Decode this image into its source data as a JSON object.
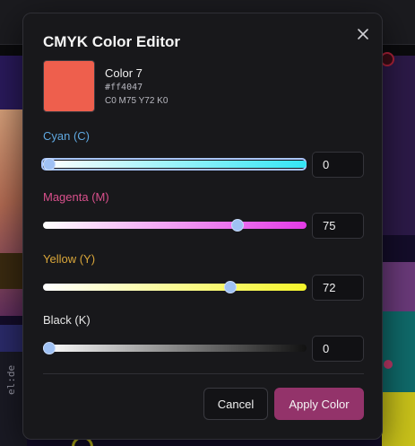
{
  "dialog": {
    "title": "CMYK Color Editor",
    "close_icon": "close-icon"
  },
  "color": {
    "name": "Color 7",
    "hex": "#ff4047",
    "cmyk_text": "C0 M75 Y72 K0",
    "swatch_hex": "#ee5f4d"
  },
  "channels": [
    {
      "label": "Cyan (C)",
      "value": "0",
      "fraction": 0.0,
      "label_color": "#5fa8e0",
      "track_from": "#ffffff",
      "track_to": "#33e6f5"
    },
    {
      "label": "Magenta (M)",
      "value": "75",
      "fraction": 0.75,
      "label_color": "#d9508c",
      "track_from": "#ffffff",
      "track_to": "#e33ae6"
    },
    {
      "label": "Yellow (Y)",
      "value": "72",
      "fraction": 0.72,
      "label_color": "#d9a63a",
      "track_from": "#ffffff",
      "track_to": "#f5f52a"
    },
    {
      "label": "Black (K)",
      "value": "0",
      "fraction": 0.0,
      "label_color": "#e6e6e6",
      "track_from": "#ffffff",
      "track_to": "#111111"
    }
  ],
  "buttons": {
    "cancel": "Cancel",
    "apply": "Apply Color"
  },
  "background": {
    "side_text": "el:de"
  },
  "colors": {
    "accent": "#93336a",
    "focus_ring": "#a9c7ff"
  }
}
